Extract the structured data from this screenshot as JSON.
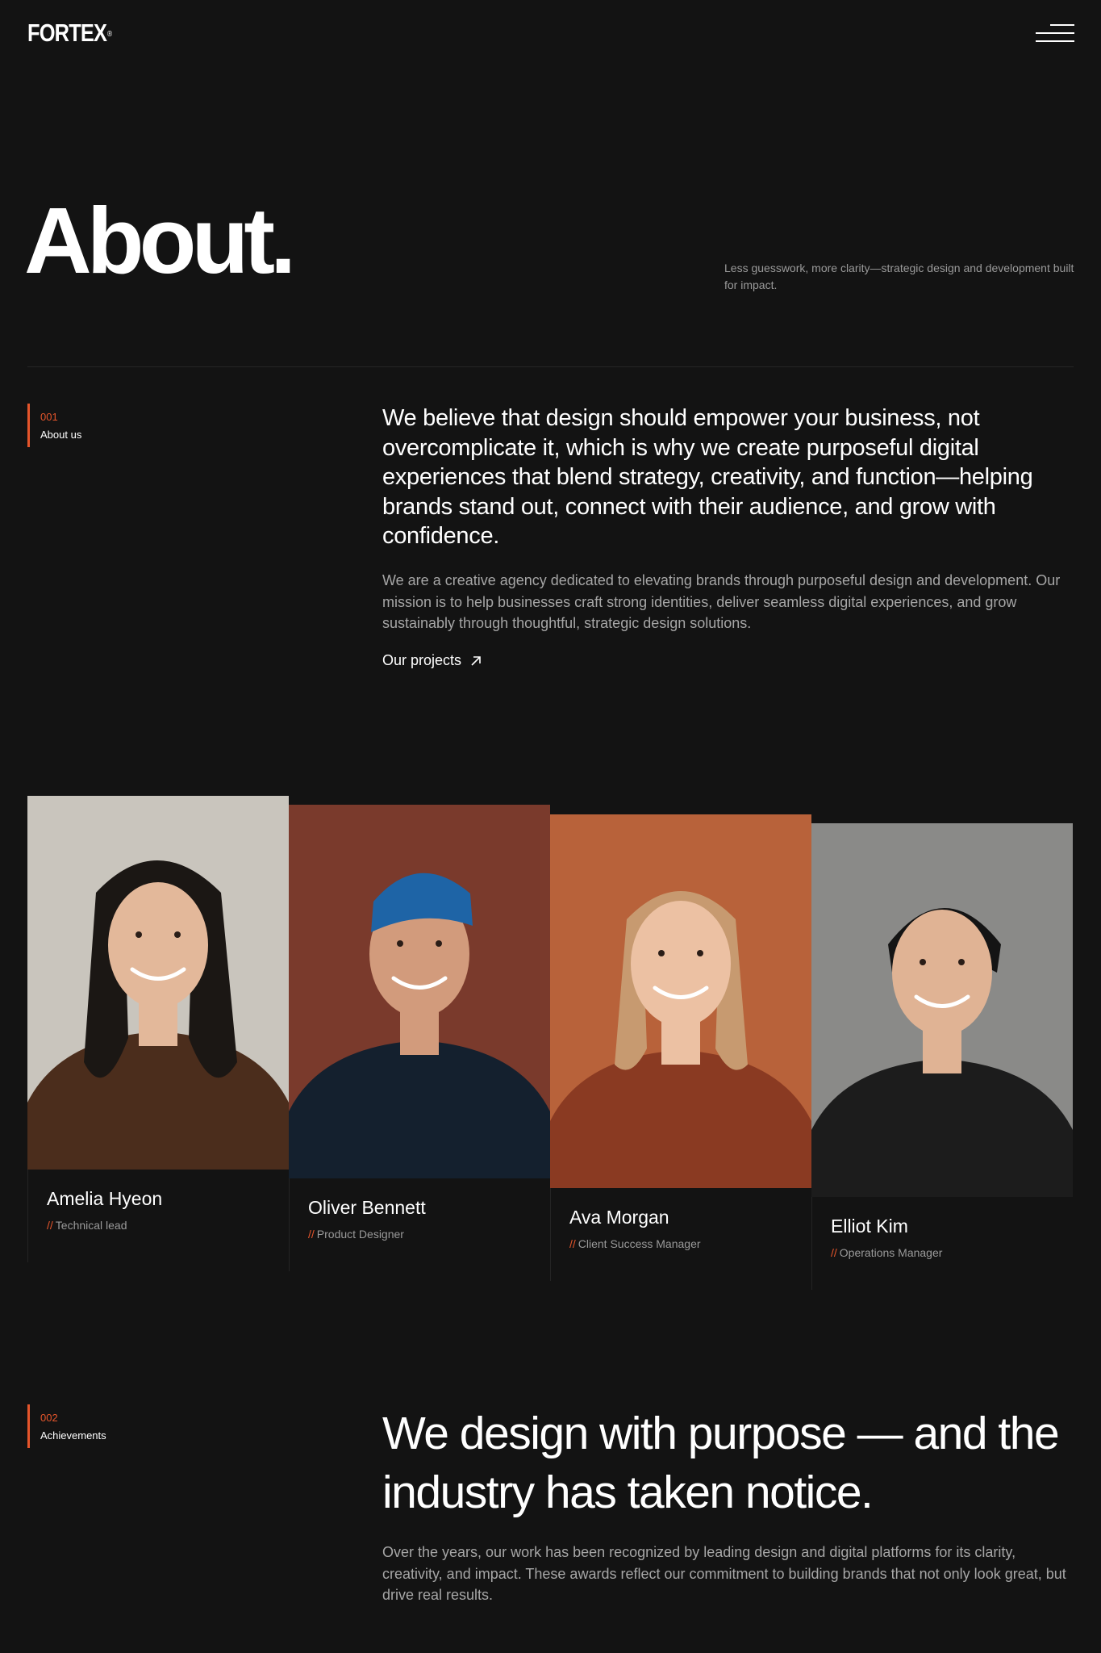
{
  "header": {
    "logo": "FORTEX",
    "logo_mark": "®"
  },
  "hero": {
    "title": "About.",
    "tagline": "Less guesswork, more clarity—strategic design and development built for impact."
  },
  "about": {
    "number": "001",
    "label": "About us",
    "lead": "We believe that design should empower your business, not overcomplicate it, which is why we create purposeful digital experiences that blend strategy, creativity, and function—helping brands stand out, connect with their audience, and grow with confidence.",
    "body": "We are a creative agency dedicated to elevating brands through purposeful design and development. Our mission is to help businesses craft strong identities, deliver seamless digital experiences, and grow sustainably through thoughtful, strategic design solutions.",
    "link_label": "Our projects"
  },
  "team": [
    {
      "name": "Amelia Hyeon",
      "role": "Technical lead",
      "bg": "#c9c5bd",
      "skin": "#e3b89a",
      "hair": "#1b1714",
      "top": "#4b2d1c"
    },
    {
      "name": "Oliver Bennett",
      "role": "Product Designer",
      "bg": "#7a3a2c",
      "skin": "#d29b7c",
      "hair": "#2d2018",
      "top": "#14202e",
      "hat": "#1e64a6"
    },
    {
      "name": "Ava Morgan",
      "role": "Client Success Manager",
      "bg": "#b8623a",
      "skin": "#ecc1a3",
      "hair": "#c79a70",
      "top": "#8a3a22"
    },
    {
      "name": "Elliot Kim",
      "role": "Operations Manager",
      "bg": "#8a8a88",
      "skin": "#e0b394",
      "hair": "#141414",
      "top": "#1c1c1c"
    }
  ],
  "role_prefix": "//",
  "achievements": {
    "number": "002",
    "label": "Achievements",
    "heading": "We design with purpose — and the industry has taken notice.",
    "body": "Over the years, our work has been recognized by leading design and digital platforms for its clarity, creativity, and impact. These awards reflect our commitment to building brands that not only look great, but drive real results."
  }
}
